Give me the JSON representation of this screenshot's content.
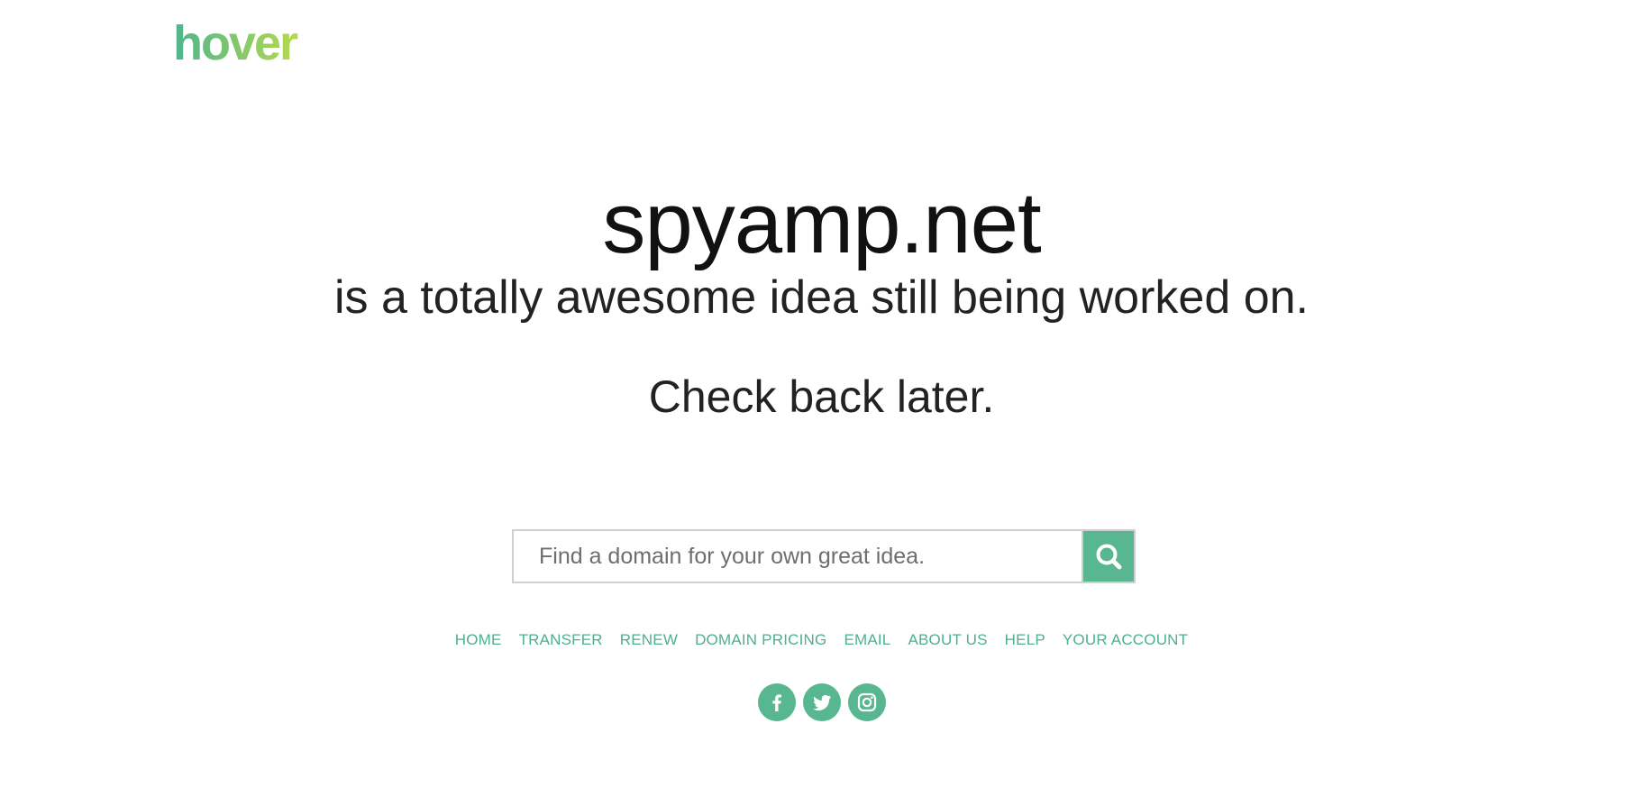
{
  "brand": {
    "logo_text": "hover",
    "logo_gradient_start": "#4db58f",
    "logo_gradient_end": "#b6d94c"
  },
  "hero": {
    "domain": "spyamp.net",
    "tagline": "is a totally awesome idea still being worked on.",
    "subtext": "Check back later."
  },
  "search": {
    "placeholder": "Find a domain for your own great idea.",
    "value": "",
    "button_icon": "search-icon"
  },
  "nav": {
    "items": [
      {
        "label": "HOME"
      },
      {
        "label": "TRANSFER"
      },
      {
        "label": "RENEW"
      },
      {
        "label": "DOMAIN PRICING"
      },
      {
        "label": "EMAIL"
      },
      {
        "label": "ABOUT US"
      },
      {
        "label": "HELP"
      },
      {
        "label": "YOUR ACCOUNT"
      }
    ]
  },
  "social": {
    "icons": [
      "facebook-icon",
      "twitter-icon",
      "instagram-icon"
    ]
  },
  "colors": {
    "accent": "#58b791",
    "link": "#4fb08b",
    "text": "#111111",
    "border": "#cfcfcf"
  }
}
